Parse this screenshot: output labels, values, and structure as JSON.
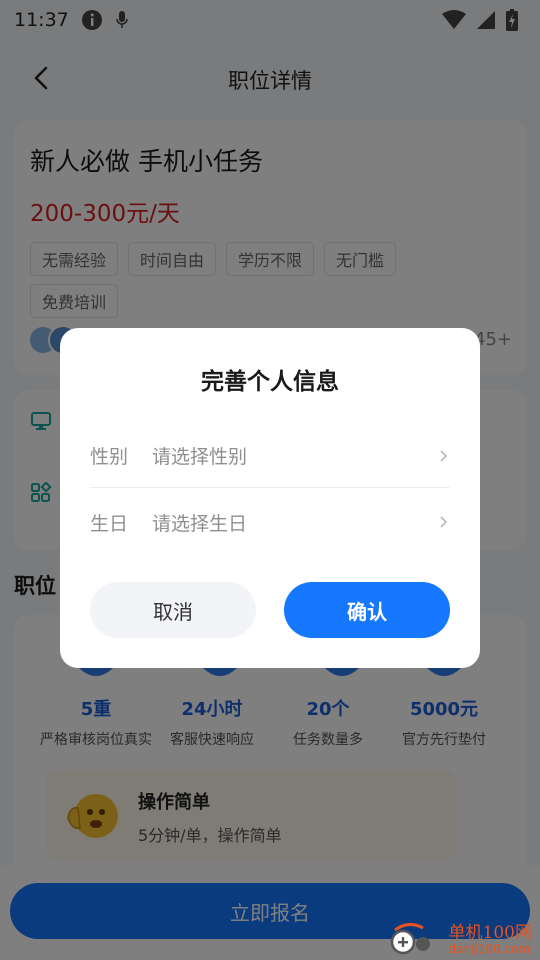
{
  "status_bar": {
    "time": "11:37"
  },
  "nav": {
    "title": "职位详情"
  },
  "job": {
    "title": "新人必做 手机小任务",
    "salary": "200-300元/天",
    "tags": [
      "无需经验",
      "时间自由",
      "学历不限",
      "无门槛",
      "免费培训"
    ],
    "applicant_count": "45+"
  },
  "section": {
    "title": "职位"
  },
  "stats": [
    {
      "value": "5重",
      "desc": "严格审核岗位真实"
    },
    {
      "value": "24小时",
      "desc": "客服快速响应"
    },
    {
      "value": "20个",
      "desc": "任务数量多"
    },
    {
      "value": "5000元",
      "desc": "官方先行垫付"
    }
  ],
  "feature": {
    "title": "操作简单",
    "desc": "5分钟/单，操作简单"
  },
  "bottom": {
    "signup_label": "立即报名"
  },
  "watermark": {
    "name": "单机100网",
    "url": "danji100.com"
  },
  "dialog": {
    "title": "完善个人信息",
    "gender_label": "性别",
    "gender_placeholder": "请选择性别",
    "birthday_label": "生日",
    "birthday_placeholder": "请选择生日",
    "cancel_label": "取消",
    "confirm_label": "确认"
  },
  "colors": {
    "accent": "#1677FF",
    "salary": "#D81E1E",
    "stat_blue": "#1F5FD9"
  }
}
